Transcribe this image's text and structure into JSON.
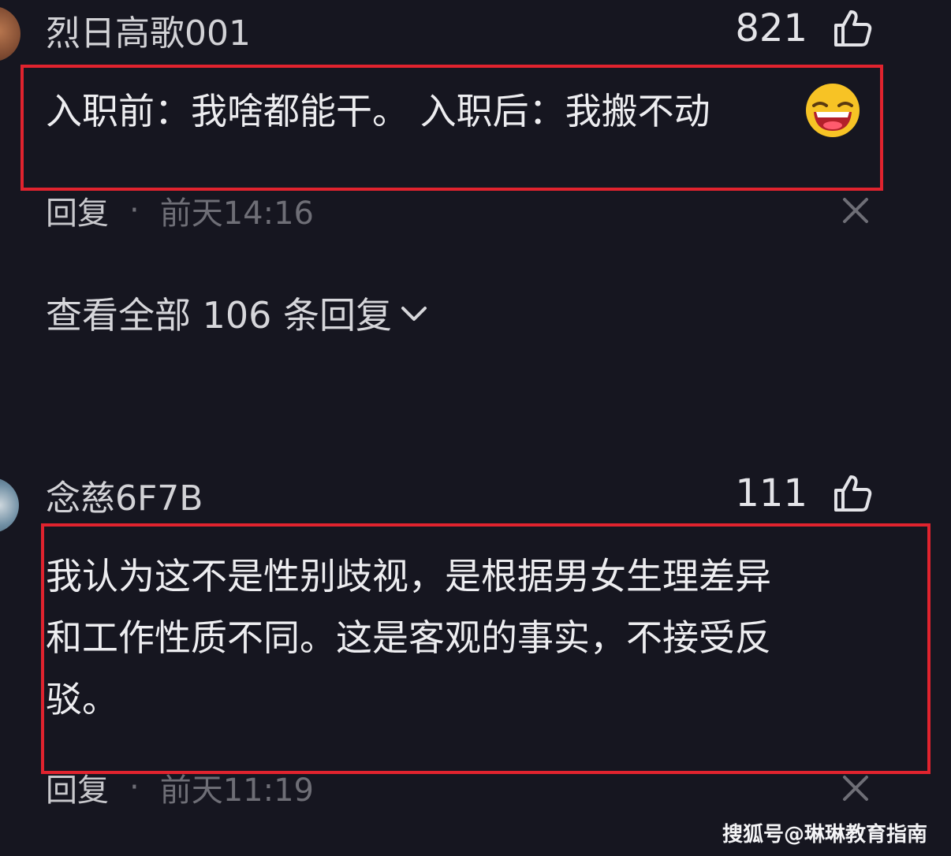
{
  "comments": [
    {
      "username": "烈日高歌001",
      "likes": "821",
      "text": "入职前：我啥都能干。 入职后：我搬不动",
      "emoji": "laughing-emoji",
      "reply_label": "回复",
      "separator": "·",
      "timestamp": "前天14:16"
    },
    {
      "username": "念慈6F7B",
      "likes": "111",
      "text_lines": [
        "我认为这不是性别歧视，是根据男女生理差异",
        "和工作性质不同。这是客观的事实，不接受反",
        "驳。"
      ],
      "reply_label": "回复",
      "separator": "·",
      "timestamp": "前天11:19"
    }
  ],
  "view_all_replies": "查看全部 106 条回复",
  "watermark": "搜狐号@琳琳教育指南",
  "colors": {
    "background": "#161620",
    "highlight_box": "#e0232e",
    "muted_text": "#6e6e76"
  }
}
